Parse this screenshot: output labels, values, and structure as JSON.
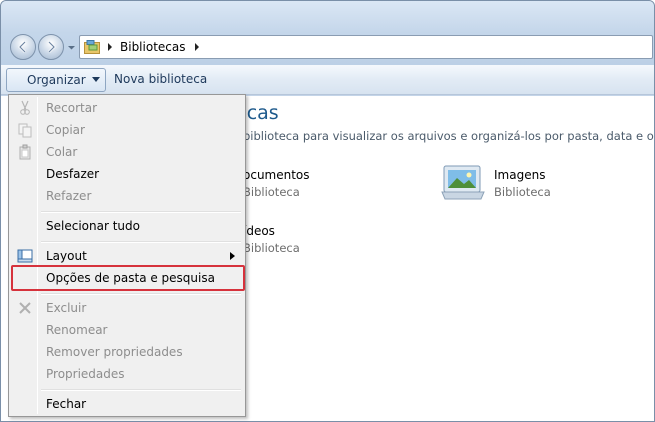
{
  "address": {
    "location": "Bibliotecas"
  },
  "toolbar": {
    "organizar_label": "Organizar",
    "nova_biblioteca_label": "Nova biblioteca"
  },
  "content": {
    "title_fragment": "ecas",
    "description_fragment": "biblioteca para visualizar os arquivos e organizá-los por pasta, data e outras pro",
    "items": [
      {
        "name": "ocumentos",
        "subtitle": "Biblioteca"
      },
      {
        "name": "Imagens",
        "subtitle": "Biblioteca"
      },
      {
        "name": "ídeos",
        "subtitle": "Biblioteca"
      }
    ]
  },
  "menu": {
    "recortar": "Recortar",
    "copiar": "Copiar",
    "colar": "Colar",
    "desfazer": "Desfazer",
    "refazer": "Refazer",
    "selecionar_tudo": "Selecionar tudo",
    "layout": "Layout",
    "opcoes": "Opções de pasta e pesquisa",
    "excluir": "Excluir",
    "renomear": "Renomear",
    "remover_propriedades": "Remover propriedades",
    "propriedades": "Propriedades",
    "fechar": "Fechar"
  },
  "colors": {
    "highlight_border": "#d6323c",
    "title_blue": "#1e5a8c",
    "disabled_text": "#8d8d8d"
  },
  "icons": {
    "back": "arrow-left-icon",
    "forward": "arrow-right-icon",
    "folder": "library-folder-icon",
    "cut": "scissors-icon",
    "copy": "copy-icon",
    "paste": "clipboard-icon",
    "layout": "layout-icon",
    "delete": "delete-x-icon",
    "images": "pictures-library-icon"
  }
}
